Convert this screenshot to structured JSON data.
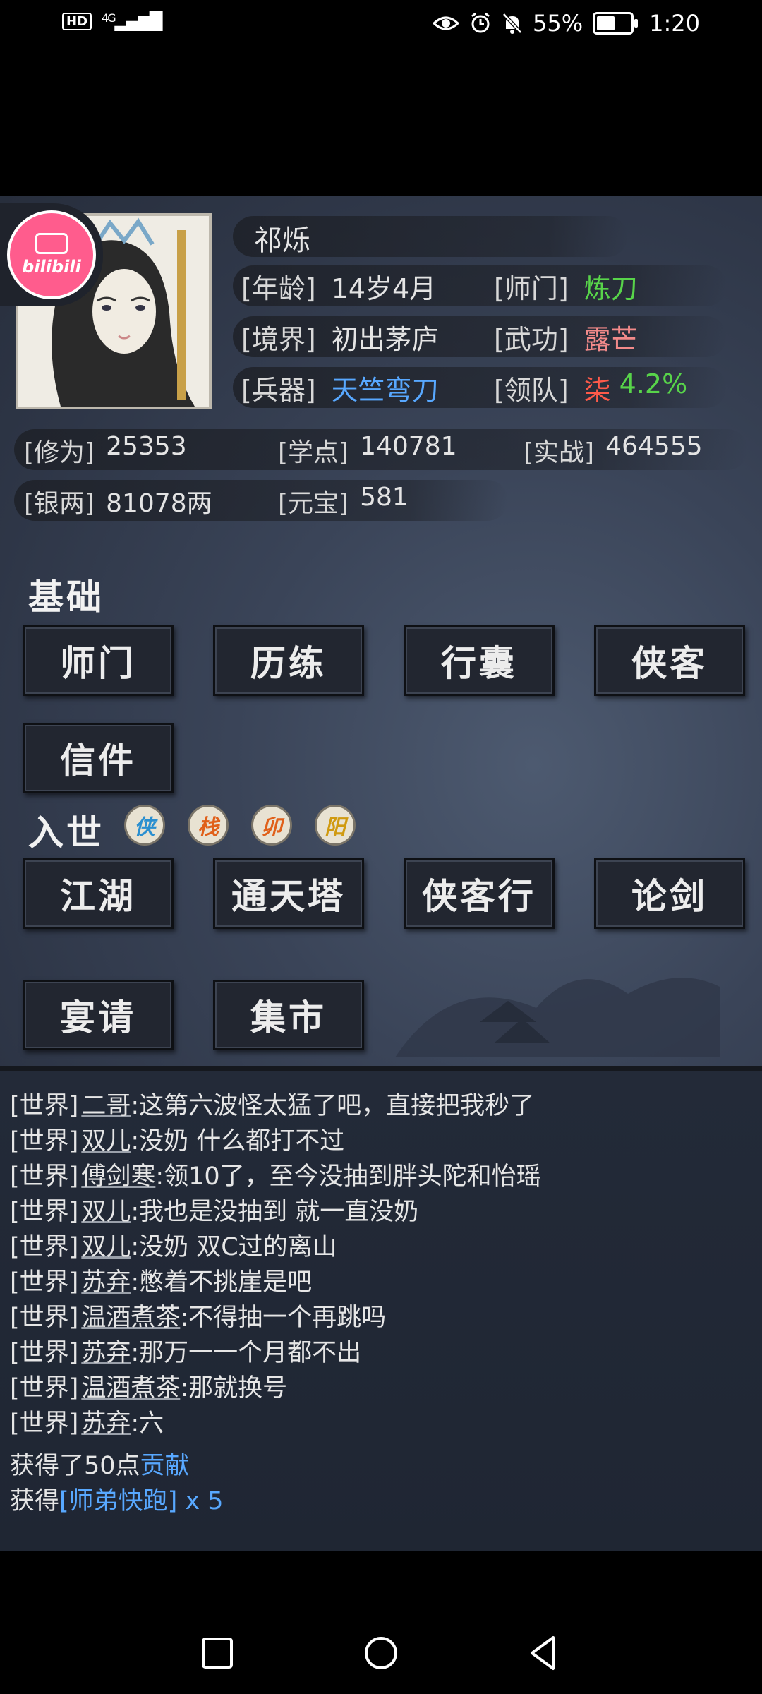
{
  "status_bar": {
    "hd": "HD",
    "network": "4G",
    "battery": "55%",
    "battery_level": 0.55,
    "time": "1:20"
  },
  "overlay": {
    "bilibili": "bilibili"
  },
  "profile": {
    "name": "祁烁",
    "fields": [
      {
        "label": "[年龄]",
        "value": "14岁4月"
      },
      {
        "label": "[师门]",
        "value": "炼刀"
      },
      {
        "label": "[境界]",
        "value": "初出茅庐"
      },
      {
        "label": "[武功]",
        "value": "露芒"
      },
      {
        "label": "[兵器]",
        "value": "天竺弯刀"
      },
      {
        "label": "[领队]",
        "value": "柒",
        "value2": "4.2%"
      }
    ],
    "stats": [
      {
        "label": "[修为]",
        "value": "25353"
      },
      {
        "label": "[学点]",
        "value": "140781"
      },
      {
        "label": "[实战]",
        "value": "464555"
      },
      {
        "label": "[银两]",
        "value": "81078两"
      },
      {
        "label": "[元宝]",
        "value": "581"
      }
    ]
  },
  "sections": {
    "basic_title": "基础",
    "basic_buttons": [
      "师门",
      "历练",
      "行囊",
      "侠客",
      "信件"
    ],
    "world_title": "入世",
    "world_badges": [
      "侠",
      "栈",
      "卯",
      "阳"
    ],
    "world_buttons": [
      "江湖",
      "通天塔",
      "侠客行",
      "论剑",
      "宴请",
      "集市"
    ]
  },
  "colors": {
    "green": "#58d44a",
    "blue": "#58a8ff",
    "pink": "#f28a8a",
    "red": "#ff5a4a"
  },
  "chat": {
    "lines": [
      {
        "channel": "[世界]",
        "user": "二哥",
        "text": ":这第六波怪太猛了吧，直接把我秒了"
      },
      {
        "channel": "[世界]",
        "user": "双儿",
        "text": ":没奶 什么都打不过"
      },
      {
        "channel": "[世界]",
        "user": "傅剑寒",
        "text": ":领10了，至今没抽到胖头陀和怡瑶"
      },
      {
        "channel": "[世界]",
        "user": "双儿",
        "text": ":我也是没抽到 就一直没奶"
      },
      {
        "channel": "[世界]",
        "user": "双儿",
        "text": ":没奶 双C过的离山"
      },
      {
        "channel": "[世界]",
        "user": "苏弃",
        "text": ":憋着不挑崖是吧"
      },
      {
        "channel": "[世界]",
        "user": "温酒煮茶",
        "text": ":不得抽一个再跳吗"
      },
      {
        "channel": "[世界]",
        "user": "苏弃",
        "text": ":那万一一个月都不出"
      },
      {
        "channel": "[世界]",
        "user": "温酒煮茶",
        "text": ":那就换号"
      },
      {
        "channel": "[世界]",
        "user": "苏弃",
        "text": ":六"
      }
    ],
    "reward1_prefix": "获得了50点",
    "reward1_highlight": "贡献",
    "reward2_prefix": "获得",
    "reward2_highlight": "[师弟快跑] x 5"
  }
}
